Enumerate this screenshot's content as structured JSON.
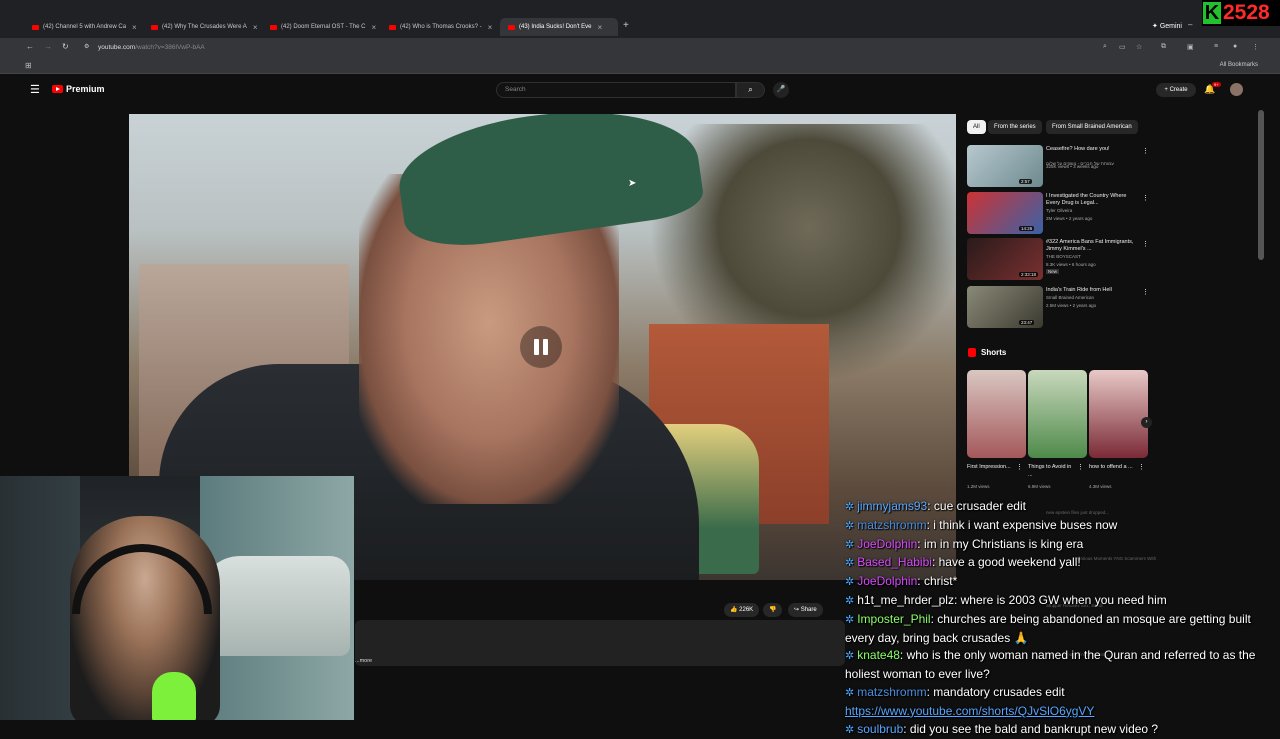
{
  "browser": {
    "tabs": [
      {
        "title": "(42) Channel 5 with Andrew Ca",
        "active": false
      },
      {
        "title": "(42) Why The Crusades Were A",
        "active": false
      },
      {
        "title": "(42) Doom Eternal OST - The C",
        "active": false
      },
      {
        "title": "(42) Who is Thomas Crooks? -",
        "active": false
      },
      {
        "title": "(43) India Sucks! Don't Eve",
        "active": true
      }
    ],
    "gemini_label": "Gemini",
    "url_host": "youtube.com",
    "url_path": "/watch?v=386lVwP-bAA",
    "all_bookmarks": "All Bookmarks"
  },
  "overlay": {
    "k_letter": "K",
    "counter": "2528"
  },
  "youtube": {
    "logo_text": "Premium",
    "search_placeholder": "Search",
    "create_label": "Create",
    "notifications_count": "9+",
    "like_count": "226K",
    "share_label": "Share",
    "more_label": "...more",
    "chips": [
      "All",
      "From the series",
      "From Small Brained American"
    ],
    "recommendations": [
      {
        "title": "Ceasefire? How dare you!",
        "channel": "עמותת של חברים - נושקים על שלום",
        "meta": "325K views • 3 weeks ago",
        "duration": "2:57",
        "color": "#9bb0b8"
      },
      {
        "title": "I Investigated the Country Where Every Drug is Legal...",
        "channel": "Tyler Oliveira",
        "meta": "2M views • 2 years ago",
        "duration": "14:26",
        "color": "#4e6d9a"
      },
      {
        "title": "#322 America Bans Fat Immigrants, Jimmy Kimmel's ...",
        "channel": "THE BOYSCAST",
        "meta": "8.3K views • 6 hours ago",
        "duration": "2:33:18",
        "badge": "New",
        "color": "#3a2a2a"
      },
      {
        "title": "India's Train Ride from Hell",
        "channel": "Small Brained American",
        "meta": "2.5M views • 2 years ago",
        "duration": "23:47",
        "color": "#6b6a5a"
      }
    ],
    "shorts_heading": "Shorts",
    "shorts": [
      {
        "title": "First Impression...",
        "views": "1.2M views",
        "color": "#a4585a"
      },
      {
        "title": "Things to Avoid in ...",
        "views": "6.9M views",
        "color": "#4e8a4a"
      },
      {
        "title": "how to offend a ...",
        "views": "4.3M views",
        "color": "#7a2a36"
      }
    ],
    "ghost_recs": [
      "new epstein files just dropped...",
      "Hilarious Moments YNG Scammers With",
      "Stripper Refuses Sex, Saudi",
      "Thieves Steal Chinese Tourists"
    ]
  },
  "chat": [
    {
      "user": "jimmyjams93",
      "color": "#5aa6ff",
      "text": "cue crusader edit"
    },
    {
      "user": "matzshromm",
      "color": "#4a8fe0",
      "text": "i think i want expensive buses now"
    },
    {
      "user": "JoeDolphin",
      "color": "#d94aff",
      "text": "im in my Christians is king era"
    },
    {
      "user": "Based_Habibi",
      "color": "#d94aff",
      "text": "have a good weekend yall!"
    },
    {
      "user": "JoeDolphin",
      "color": "#d94aff",
      "text": "christ*"
    },
    {
      "user": "h1t_me_hrder_plz",
      "color": "#ffffff",
      "text": "where is 2003 GW when you need him"
    },
    {
      "user": "Imposter_Phil",
      "color": "#8bff6a",
      "text": "churches are being abandoned an mosque are getting built every day, bring back crusades 🙏"
    },
    {
      "user": "knate48",
      "color": "#8bff6a",
      "text": "who is the only woman named in the Quran and referred to as the holiest woman to ever live?"
    },
    {
      "user": "matzshromm",
      "color": "#4a8fe0",
      "text": "mandatory crusades edit"
    },
    {
      "user": "",
      "color": "#58a6ff",
      "link": "https://www.youtube.com/shorts/QJvSlO6ygVY"
    },
    {
      "user": "soulbrub",
      "color": "#5aa6ff",
      "text": "did you see the bald and bankrupt new video ?"
    }
  ]
}
